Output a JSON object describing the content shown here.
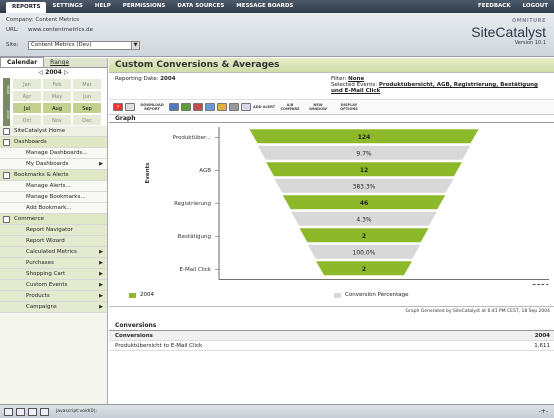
{
  "topnav": {
    "items": [
      "REPORTS",
      "SETTINGS",
      "HELP",
      "PERMISSIONS",
      "DATA SOURCES",
      "MESSAGE BOARDS"
    ],
    "right": [
      "FEEDBACK",
      "LOGOUT"
    ]
  },
  "header": {
    "company": "Company: Content Metrics",
    "url_label": "URL:",
    "url": "www.contentmetrics.de",
    "site_label": "Site:",
    "site_value": "Content Metrics (Dev)",
    "logo_omni": "OMNITURE",
    "logo_name": "SiteCatalyst",
    "logo_version": "Version 10.1"
  },
  "calendar": {
    "tab_calendar": "Calendar",
    "tab_range": "Range",
    "year": "2004",
    "prev": "◁",
    "next": "▷",
    "quarters": [
      "YEAR",
      "2004"
    ],
    "months": [
      "Jan",
      "Feb",
      "Mar",
      "Apr",
      "May",
      "Jun",
      "Jul",
      "Aug",
      "Sep",
      "Oct",
      "Nov",
      "Dec"
    ]
  },
  "nav": {
    "items": [
      {
        "label": "SiteCatalyst Home",
        "type": "top"
      },
      {
        "label": "Dashboards",
        "type": "sec"
      },
      {
        "label": "Manage Dashboards...",
        "type": "item"
      },
      {
        "label": "My Dashboards",
        "type": "item",
        "caret": true
      },
      {
        "label": "Bookmarks & Alerts",
        "type": "sec"
      },
      {
        "label": "Manage Alerts...",
        "type": "item"
      },
      {
        "label": "Manage Bookmarks...",
        "type": "item"
      },
      {
        "label": "Add Bookmark...",
        "type": "item"
      },
      {
        "label": "Commerce",
        "type": "sec"
      },
      {
        "label": "Report Navigator",
        "type": "sub"
      },
      {
        "label": "Report Wizard",
        "type": "sub"
      },
      {
        "label": "Calculated Metrics",
        "type": "sub",
        "caret": true
      },
      {
        "label": "Purchases",
        "type": "sub",
        "caret": true
      },
      {
        "label": "Shopping Cart",
        "type": "sub",
        "caret": true
      },
      {
        "label": "Custom Events",
        "type": "sub",
        "caret": true
      },
      {
        "label": "Products",
        "type": "sub",
        "caret": true
      },
      {
        "label": "Campaigns",
        "type": "sub",
        "caret": true
      }
    ]
  },
  "report": {
    "title": "Custom Conversions & Averages",
    "reporting_date_label": "Reporting Date:",
    "reporting_date": "2004",
    "filter_label": "Filter:",
    "filter_value": "None",
    "selected_events_label": "Selected Events:",
    "selected_events": "Produktübersicht, AGB, Registrierung, Bestätigung und E-Mail Click",
    "toolbar": {
      "download": "DOWNLOAD REPORT",
      "add_alert": "ADD ALERT",
      "compare": "A/B COMPARE",
      "new_window": "NEW WINDOW",
      "display_options": "DISPLAY OPTIONS"
    },
    "graph_label": "Graph",
    "y_axis_label": "Events",
    "x_axis_end": "2004",
    "legend": [
      "2004",
      "Conversion Percentage"
    ],
    "footer_note": "Graph Generated by SiteCatalyst at 6:41 PM CEST, 18 Sep 2004",
    "conversions_title": "Conversions",
    "conv_header": [
      "Conversions",
      "2004"
    ],
    "conv_rows": [
      [
        "Produktübersicht to E-Mail Click",
        "1,611"
      ]
    ]
  },
  "chart_data": {
    "type": "bar",
    "subtype": "funnel",
    "categories": [
      "Produktüber...",
      "AGB",
      "Registrierung",
      "Bestätigung",
      "E-Mail Click"
    ],
    "values_labels": [
      "124",
      "12",
      "46",
      "2",
      "2"
    ],
    "conversion_labels": [
      "9.7%",
      "383.3%",
      "4.3%",
      "100.0%"
    ],
    "colors": {
      "bar": "#8cb82a",
      "conversion": "#d8d8d8"
    }
  },
  "statusbar": {
    "text": "javascript:void(0);",
    "right": "-+-"
  }
}
